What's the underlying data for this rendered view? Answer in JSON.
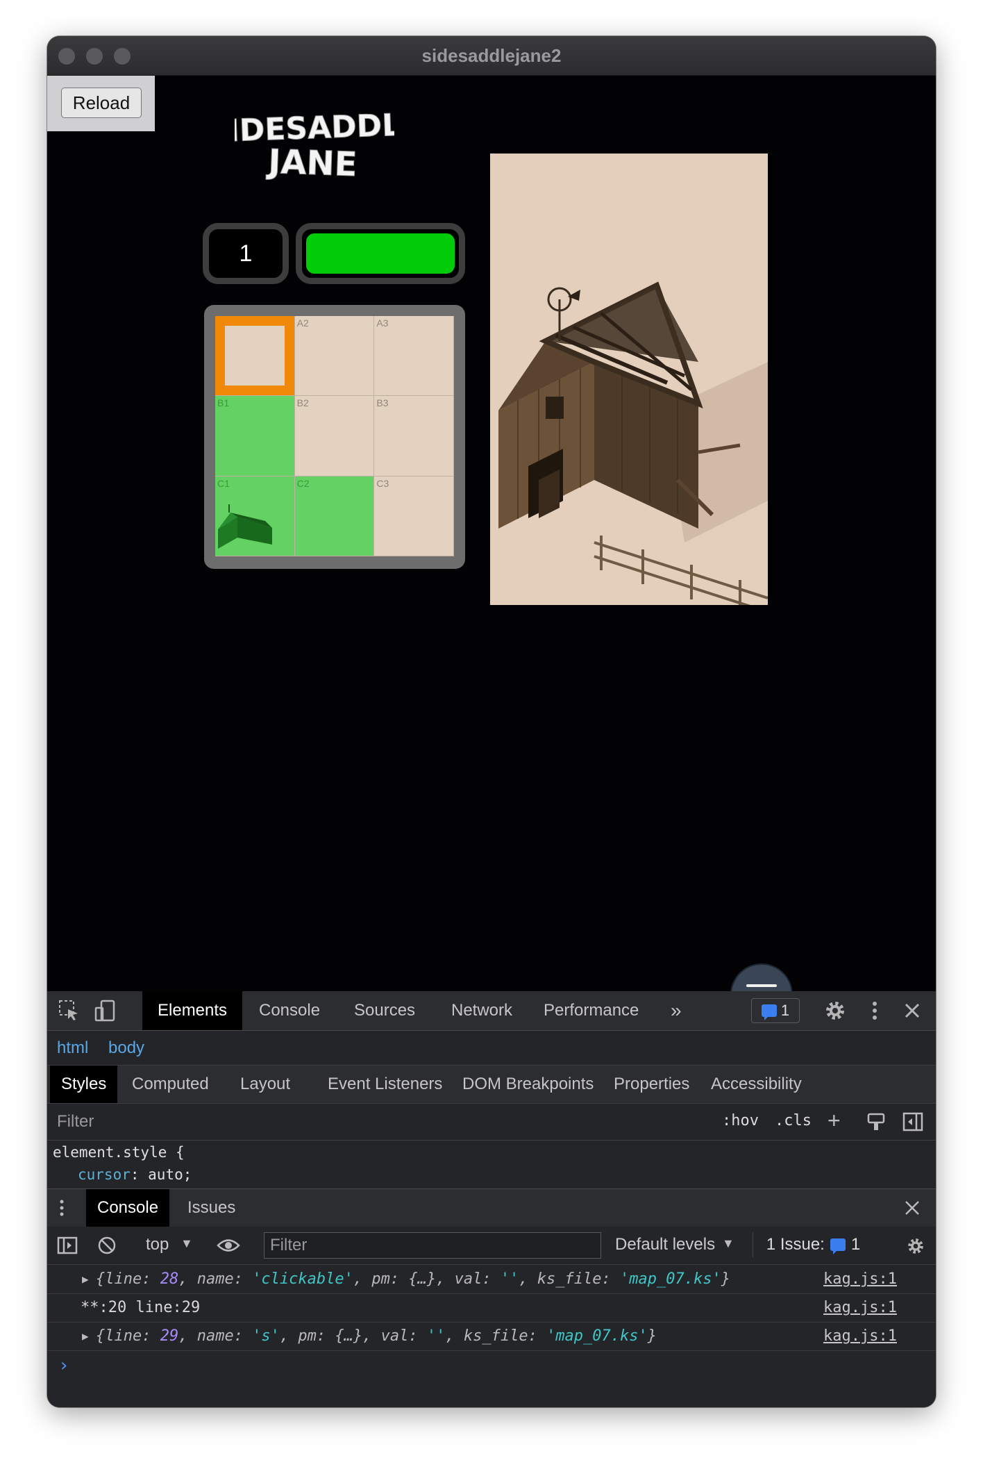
{
  "window": {
    "title": "sidesaddlejane2"
  },
  "game": {
    "reload_label": "Reload",
    "logo_text_line1": "SIDESADDLE",
    "logo_text_line2": "JANE",
    "counter": "1",
    "health_fraction": 1.0,
    "map": {
      "cells": [
        {
          "id": "A1",
          "label": "",
          "state": "current"
        },
        {
          "id": "A2",
          "label": "A2",
          "state": "empty"
        },
        {
          "id": "A3",
          "label": "A3",
          "state": "empty"
        },
        {
          "id": "B1",
          "label": "B1",
          "state": "green"
        },
        {
          "id": "B2",
          "label": "B2",
          "state": "empty"
        },
        {
          "id": "B3",
          "label": "B3",
          "state": "empty"
        },
        {
          "id": "C1",
          "label": "C1",
          "state": "green"
        },
        {
          "id": "C2",
          "label": "C2",
          "state": "green"
        },
        {
          "id": "C3",
          "label": "C3",
          "state": "empty"
        }
      ]
    },
    "menu_icon": "hamburger-icon"
  },
  "devtools": {
    "tabs": [
      "Elements",
      "Console",
      "Sources",
      "Network",
      "Performance"
    ],
    "active_tab": "Elements",
    "more_tabs": "»",
    "issues_count": "1",
    "breadcrumb": [
      "html",
      "body"
    ],
    "subtabs": [
      "Styles",
      "Computed",
      "Layout",
      "Event Listeners",
      "DOM Breakpoints",
      "Properties",
      "Accessibility"
    ],
    "filter_placeholder": "Filter",
    "hov": ":hov",
    "cls": ".cls",
    "styles_selector": "element.style {",
    "styles_prop": "cursor",
    "styles_value": "auto;",
    "drawer_tabs": [
      "Console",
      "Issues"
    ],
    "context": "top",
    "console_filter_placeholder": "Filter",
    "levels": "Default levels",
    "issue_label": "1 Issue:",
    "issue_count": "1",
    "logs": [
      {
        "type": "object",
        "line": "28",
        "name": "'clickable'",
        "ks_file": "'map_07.ks'",
        "src": "kag.js:1"
      },
      {
        "type": "text",
        "text": "**:20  line:29",
        "src": "kag.js:1"
      },
      {
        "type": "object",
        "line": "29",
        "name": "'s'",
        "ks_file": "'map_07.ks'",
        "src": "kag.js:1"
      }
    ],
    "prompt": "›"
  },
  "colors": {
    "health_green": "#00cc0a",
    "current_cell": "#f0890a",
    "visited_cell": "#64d164",
    "link_blue": "#58a8e8"
  }
}
